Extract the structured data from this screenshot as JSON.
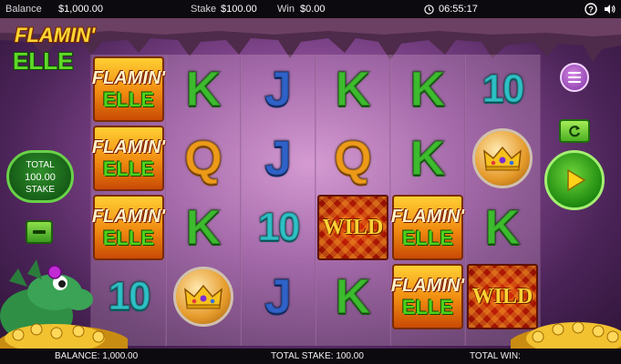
{
  "topbar": {
    "balance_label": "Balance",
    "balance_value": "$1,000.00",
    "stake_label": "Stake",
    "stake_value": "$100.00",
    "win_label": "Win",
    "win_value": "$0.00",
    "clock": "06:55:17",
    "icons": [
      "clock-icon",
      "help-icon",
      "sound-icon"
    ]
  },
  "logo": {
    "line1": "FLAMIN'",
    "line2": "ELLE"
  },
  "stake_panel": {
    "total_label": "TOTAL",
    "amount": "100.00",
    "stake_label": "STAKE"
  },
  "reels": [
    [
      "LOGO",
      "LOGO",
      "LOGO",
      "10"
    ],
    [
      "K",
      "Q",
      "K",
      "CROWN"
    ],
    [
      "J",
      "J",
      "10",
      "J"
    ],
    [
      "K",
      "Q",
      "WILD",
      "K"
    ],
    [
      "K",
      "K",
      "LOGO",
      "LOGO"
    ],
    [
      "10",
      "CROWN",
      "K",
      "WILD"
    ]
  ],
  "symbols": {
    "logo_line1": "FLAMIN'",
    "logo_line2": "ELLE",
    "wild": "WILD",
    "K": "K",
    "Q": "Q",
    "J": "J",
    "10": "10"
  },
  "bottombar": {
    "balance": "BALANCE: 1,000.00",
    "total_stake": "TOTAL STAKE:  100.00",
    "total_win": "TOTAL WIN:"
  },
  "colors": {
    "accent_green": "#3dbb2e",
    "menu_purple": "#7b2fa0",
    "bar_background": "#0d0a0f"
  }
}
